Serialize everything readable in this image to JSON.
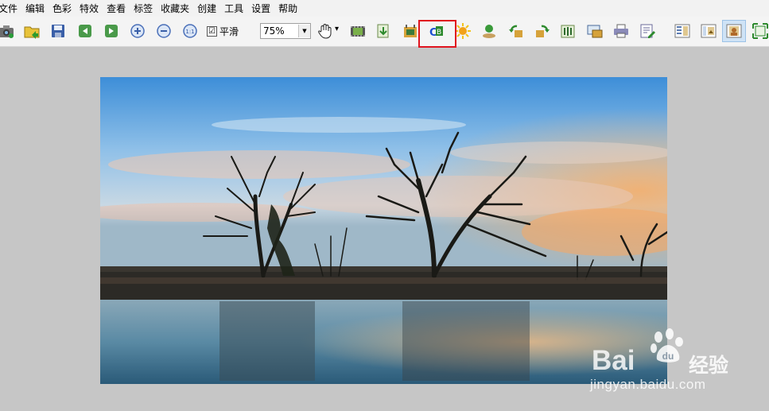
{
  "menu": [
    {
      "label": "文件"
    },
    {
      "label": "编辑"
    },
    {
      "label": "色彩"
    },
    {
      "label": "特效"
    },
    {
      "label": "查看"
    },
    {
      "label": "标签"
    },
    {
      "label": "收藏夹"
    },
    {
      "label": "创建"
    },
    {
      "label": "工具"
    },
    {
      "label": "设置"
    },
    {
      "label": "帮助"
    }
  ],
  "toolbar": {
    "smooth_label": "平滑",
    "smooth_checked": "☑",
    "zoom_value": "75%",
    "zoom_arrow": "▼",
    "pan_arrow": "▾",
    "icons": [
      "camera-icon",
      "open-folder-icon",
      "save-icon",
      "previous-icon",
      "next-icon",
      "zoom-in-icon",
      "zoom-out-icon",
      "actual-size-icon",
      "hand-tool-icon",
      "filmstrip-icon",
      "batch-convert-icon",
      "crop-icon",
      "batch-rename-icon",
      "auto-enhance-icon",
      "screen-capture-icon",
      "rotate-left-icon",
      "rotate-right-icon",
      "flip-icon",
      "slideshow-icon",
      "print-icon",
      "edit-icon",
      "layout-thumbnails-icon",
      "layout-preview-icon",
      "layout-full-icon",
      "fullscreen-icon"
    ]
  },
  "watermark": {
    "brand": "Bai",
    "brand_tail": "du",
    "cn": "经验",
    "url": "jingyan.baidu.com"
  },
  "colors": {
    "highlight": "#e0141e",
    "workspace": "#c6c6c6"
  }
}
